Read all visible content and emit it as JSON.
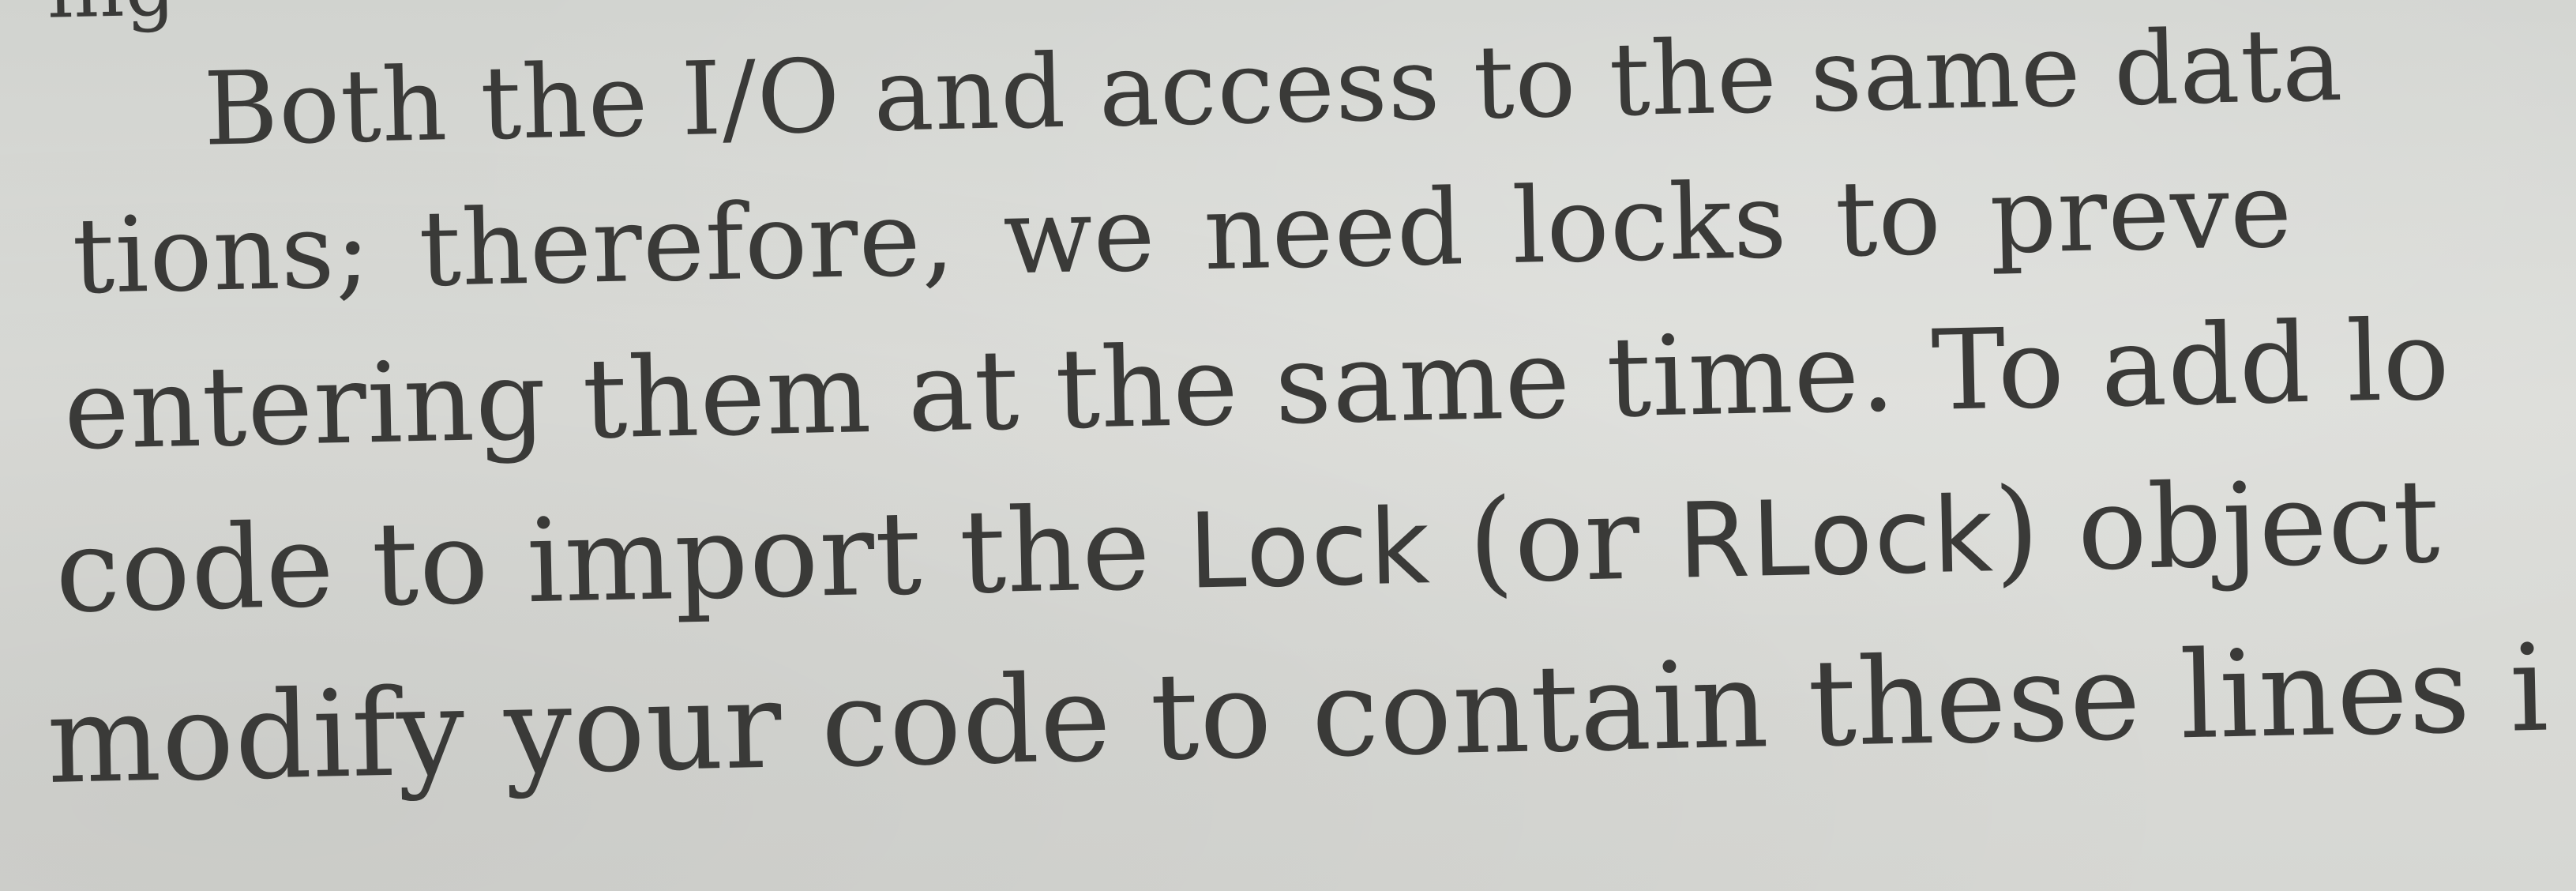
{
  "page": {
    "lines": [
      {
        "id": "line-0",
        "text": "ing"
      },
      {
        "id": "line-1",
        "text": "Both the I/O and access to the same data"
      },
      {
        "id": "line-2",
        "text": "tions; therefore, we need locks to preve"
      },
      {
        "id": "line-3",
        "text": "entering them at the same time. To add lo"
      },
      {
        "id": "line-4",
        "parts": [
          "code to import the ",
          "Lock",
          " (or ",
          "RLock",
          ") object"
        ]
      },
      {
        "id": "line-5",
        "text": "modify your code to contain these lines i"
      }
    ]
  }
}
